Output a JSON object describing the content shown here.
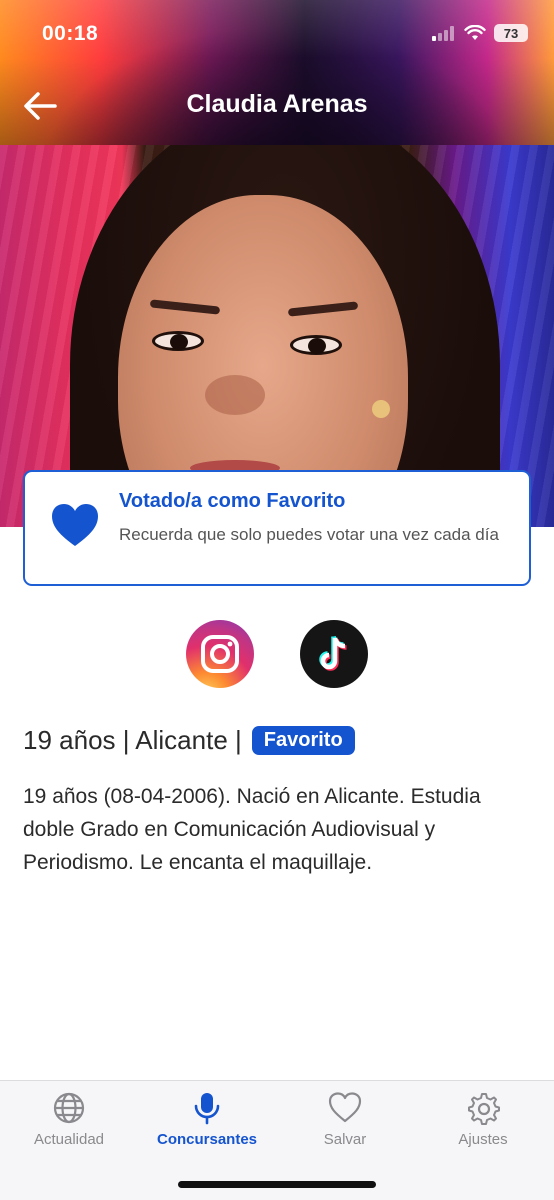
{
  "status": {
    "time": "00:18",
    "battery": "73"
  },
  "header": {
    "title": "Claudia Arenas"
  },
  "vote_card": {
    "title": "Votado/a como Favorito",
    "subtitle": "Recuerda que solo puedes votar una vez cada día"
  },
  "profile": {
    "meta": "19 años | Alicante |",
    "badge": "Favorito",
    "bio": "19 años (08-04-2006). Nació en Alicante. Estudia doble Grado en Comunicación Audiovisual y Periodismo. Le encanta el maquillaje."
  },
  "nav": {
    "items": [
      {
        "label": "Actualidad",
        "icon": "globe-icon"
      },
      {
        "label": "Concursantes",
        "icon": "microphone-icon",
        "active": true
      },
      {
        "label": "Salvar",
        "icon": "heart-icon"
      },
      {
        "label": "Ajustes",
        "icon": "gear-icon"
      }
    ]
  },
  "colors": {
    "accent": "#1554cf",
    "nav_inactive": "#8a8a8e"
  }
}
